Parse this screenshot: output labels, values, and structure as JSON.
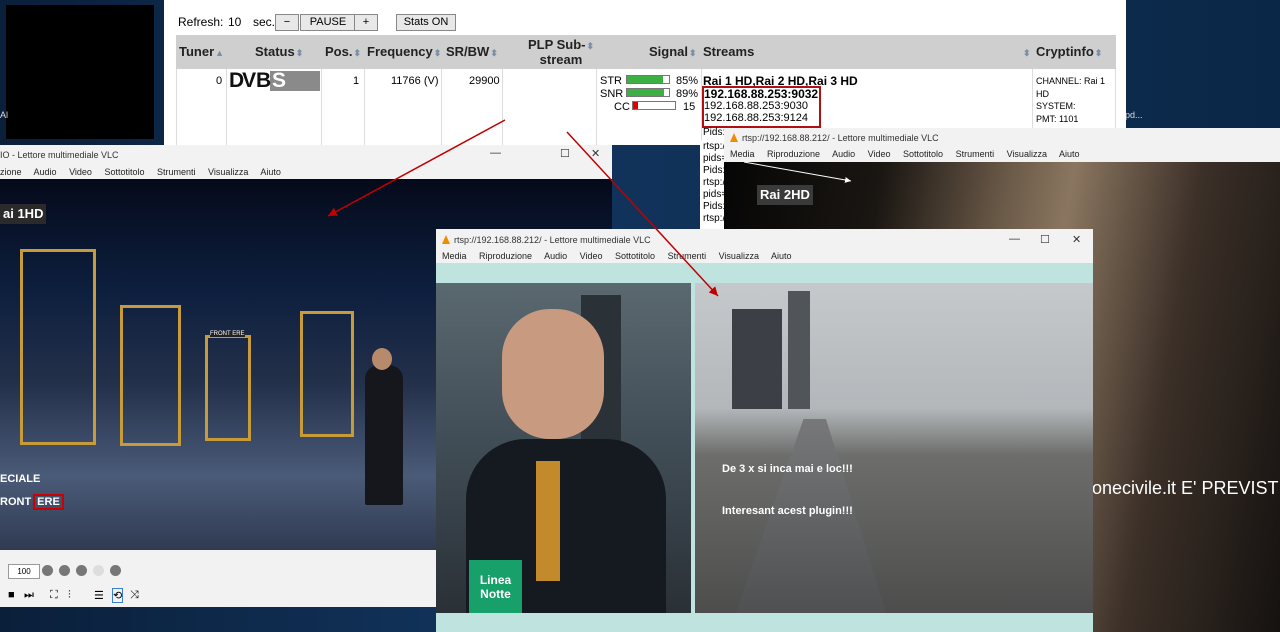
{
  "desktop": {
    "label_left": "Al",
    "label_right": "pd..."
  },
  "controls": {
    "refresh_label": "Refresh:",
    "refresh_value": "10",
    "refresh_unit": "sec.",
    "minus": "−",
    "pause": "PAUSE",
    "plus": "+",
    "stats": "Stats ON"
  },
  "table": {
    "headers": {
      "tuner": "Tuner",
      "status": "Status",
      "pos": "Pos.",
      "frequency": "Frequency",
      "srbw": "SR/BW",
      "plp1": "PLP Sub-",
      "plp2": "stream",
      "signal": "Signal",
      "streams": "Streams",
      "cryptinfo": "Cryptinfo"
    },
    "row": {
      "tuner": "0",
      "status_logo": "DVB-S",
      "status_l1": "DV",
      "status_l2": "B",
      "status_l3": "S",
      "pos": "1",
      "frequency": "11766 (V)",
      "srbw": "29900",
      "str_label": "STR",
      "str_pct": "85%",
      "str_value": 0.85,
      "snr_label": "SNR",
      "snr_pct": "89%",
      "snr_value": 0.89,
      "cc_label": "CC",
      "cc_value": "15",
      "channels": "Rai 1 HD,Rai 2 HD,Rai 3 HD",
      "stream1": "192.168.88.253:9032",
      "stream2": "192.168.88.253:9030",
      "stream3": "192.168.88.253:9124",
      "pids": [
        "Pids:",
        "rtsp:/",
        "pids=",
        "Pids:",
        "rtsp:/",
        "pids=",
        "Pids:",
        "rtsp:/"
      ],
      "crypt_l1": "CHANNEL: Rai 1",
      "crypt_l2": "HD",
      "crypt_l3": "SYSTEM:",
      "crypt_l4": "PMT: 1101"
    }
  },
  "vlc_left": {
    "title": "IO - Lettore multimediale VLC",
    "menu": [
      "zione",
      "Audio",
      "Video",
      "Sottotitolo",
      "Strumenti",
      "Visualizza",
      "Aiuto"
    ],
    "channel_logo": "ai 1HD",
    "overlay_1": "ECIALE",
    "overlay_2": "RONT",
    "overlay_3": "ERE",
    "set_sign": "FRONT ERE",
    "volume": "100"
  },
  "vlc_right": {
    "title": "rtsp://192.168.88.212/ - Lettore multimediale VLC",
    "menu": [
      "Media",
      "Riproduzione",
      "Audio",
      "Video",
      "Sottotitolo",
      "Strumenti",
      "Visualizza",
      "Aiuto"
    ],
    "channel_logo": "Rai 2HD",
    "ticker": "onecivile.it E' PREVIST"
  },
  "vlc_center": {
    "title": "rtsp://192.168.88.212/ - Lettore multimediale VLC",
    "menu": [
      "Media",
      "Riproduzione",
      "Audio",
      "Video",
      "Sottotitolo",
      "Strumenti",
      "Visualizza",
      "Aiuto"
    ],
    "logo_l1": "Linea",
    "logo_l2": "Notte",
    "comment1": "De 3 x si inca mai e loc!!!",
    "comment2": "Interesant acest plugin!!!"
  },
  "colors": {
    "arrow": "#c00000",
    "bar_green": "#3cb043",
    "bar_red": "#e00000",
    "header_bg": "#cfcfcf"
  }
}
